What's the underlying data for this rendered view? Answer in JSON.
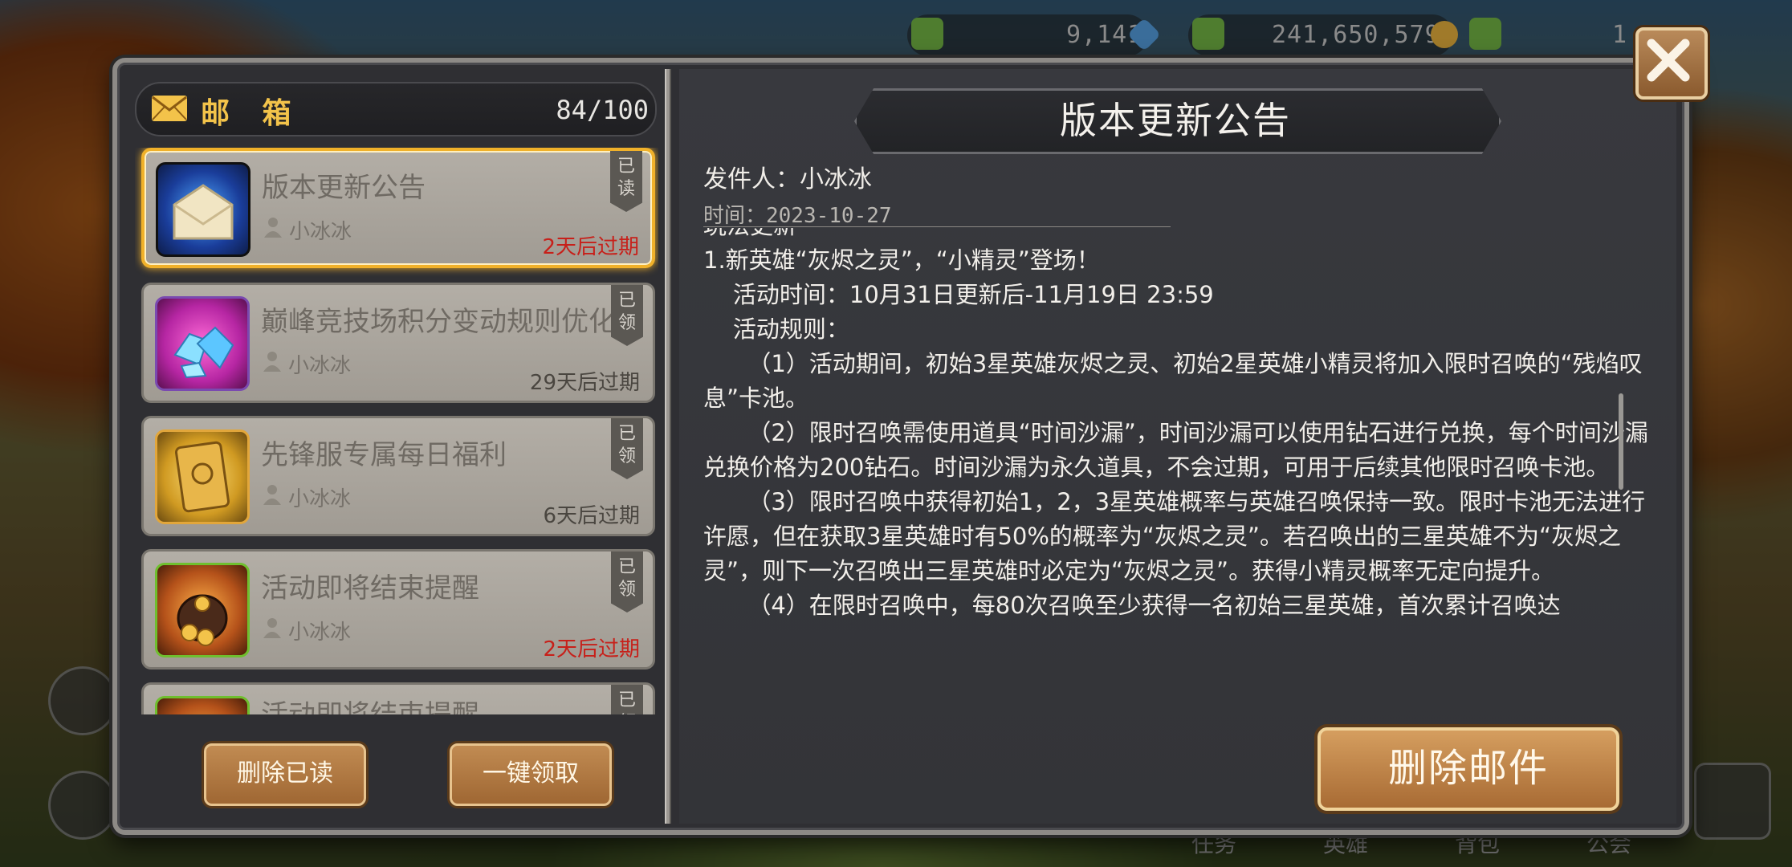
{
  "hud": {
    "diamonds": "9,141",
    "gold": "241,650,579",
    "right_value": "1"
  },
  "mailbox": {
    "title": "邮 箱",
    "count": "84/100",
    "items": [
      {
        "title": "版本更新公告",
        "sender": "小冰冰",
        "status": "已\n读",
        "expire": "2天后过期",
        "expire_color": "#c7201a",
        "icon": "envelope-icon"
      },
      {
        "title": "巅峰竞技场积分变动规则优化",
        "sender": "小冰冰",
        "status": "已\n领",
        "expire": "29天后过期",
        "expire_color": "#4a4640",
        "icon": "diamond-pile-icon"
      },
      {
        "title": "先锋服专属每日福利",
        "sender": "小冰冰",
        "status": "已\n领",
        "expire": "6天后过期",
        "expire_color": "#4a4640",
        "icon": "golden-card-icon"
      },
      {
        "title": "活动即将结束提醒",
        "sender": "小冰冰",
        "status": "已\n领",
        "expire": "2天后过期",
        "expire_color": "#c7201a",
        "icon": "gold-bag-icon"
      },
      {
        "title": "活动即将结束提醒",
        "sender": "",
        "status": "已\n领",
        "expire": "",
        "expire_color": "#4a4640",
        "icon": "gold-bag-icon"
      }
    ],
    "delete_read_label": "删除已读",
    "claim_all_label": "一键领取"
  },
  "mail": {
    "title": "版本更新公告",
    "sender": "发件人：小冰冰",
    "time": "时间：2023-10-27",
    "section_cut": "玩法更新",
    "paragraphs": [
      "1.新英雄“灰烬之灵”，“小精灵”登场！",
      "    活动时间：10月31日更新后-11月19日 23:59",
      "    活动规则：",
      "      （1）活动期间，初始3星英雄灰烬之灵、初始2星英雄小精灵将加入限时召唤的“残焰叹息”卡池。",
      "      （2）限时召唤需使用道具“时间沙漏”，时间沙漏可以使用钻石进行兑换，每个时间沙漏兑换价格为200钻石。时间沙漏为永久道具，不会过期，可用于后续其他限时召唤卡池。",
      "      （3）限时召唤中获得初始1，2，3星英雄概率与英雄召唤保持一致。限时卡池无法进行许愿，但在获取3星英雄时有50%的概率为“灰烬之灵”。若召唤出的三星英雄不为“灰烬之灵”，则下一次召唤出三星英雄时必定为“灰烬之灵”。获得小精灵概率无定向提升。",
      "      （4）在限时召唤中，每80次召唤至少获得一名初始三星英雄，首次累计召唤达"
    ],
    "delete_label": "删除邮件"
  },
  "bottom_tabs": [
    "任务",
    "英雄",
    "背包",
    "公会"
  ],
  "colors": {
    "accent_gold": "#f0b12a",
    "expire_red": "#c7201a",
    "title_gold": "#f3c34a"
  }
}
